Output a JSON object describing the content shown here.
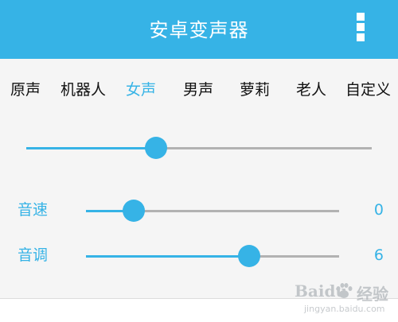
{
  "app_bar": {
    "title": "安卓变声器",
    "menu_icon": "overflow-menu-icon",
    "color": "#36b3e6"
  },
  "tabs": [
    {
      "label": "原声",
      "active": false
    },
    {
      "label": "机器人",
      "active": false
    },
    {
      "label": "女声",
      "active": true
    },
    {
      "label": "男声",
      "active": false
    },
    {
      "label": "萝莉",
      "active": false
    },
    {
      "label": "老人",
      "active": false
    },
    {
      "label": "自定义",
      "active": false
    }
  ],
  "main_slider": {
    "fraction": 0.375
  },
  "speed": {
    "label": "音速",
    "value": "0",
    "fraction": 0.19
  },
  "pitch": {
    "label": "音调",
    "value": "6",
    "fraction": 0.645
  },
  "watermark": {
    "brand": "Baidu",
    "brand_cn": "经验",
    "url": "jingyan.baidu.com"
  },
  "colors": {
    "accent": "#36b3e6",
    "track": "#b2b2b2",
    "background": "#f5f5f5"
  }
}
